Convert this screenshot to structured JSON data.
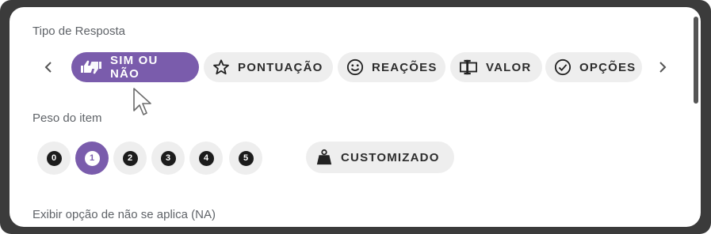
{
  "response_type": {
    "label": "Tipo de Resposta",
    "options": [
      {
        "label": "SIM OU NÃO",
        "icon": "thumbs-up-down-icon",
        "selected": true
      },
      {
        "label": "PONTUAÇÃO",
        "icon": "star-icon",
        "selected": false
      },
      {
        "label": "REAÇÕES",
        "icon": "smiley-icon",
        "selected": false
      },
      {
        "label": "VALOR",
        "icon": "text-field-icon",
        "selected": false
      },
      {
        "label": "OPÇÕES",
        "icon": "check-circle-icon",
        "selected": false
      }
    ]
  },
  "item_weight": {
    "label": "Peso do item",
    "options": [
      "0",
      "1",
      "2",
      "3",
      "4",
      "5"
    ],
    "selected": "1",
    "custom_label": "CUSTOMIZADO"
  },
  "na_option": {
    "label": "Exibir opção de não se aplica (NA)"
  },
  "colors": {
    "accent": "#7a5cac",
    "chip_background": "#eeeeee",
    "text": "#2d2d2d",
    "label": "#5f6368"
  }
}
